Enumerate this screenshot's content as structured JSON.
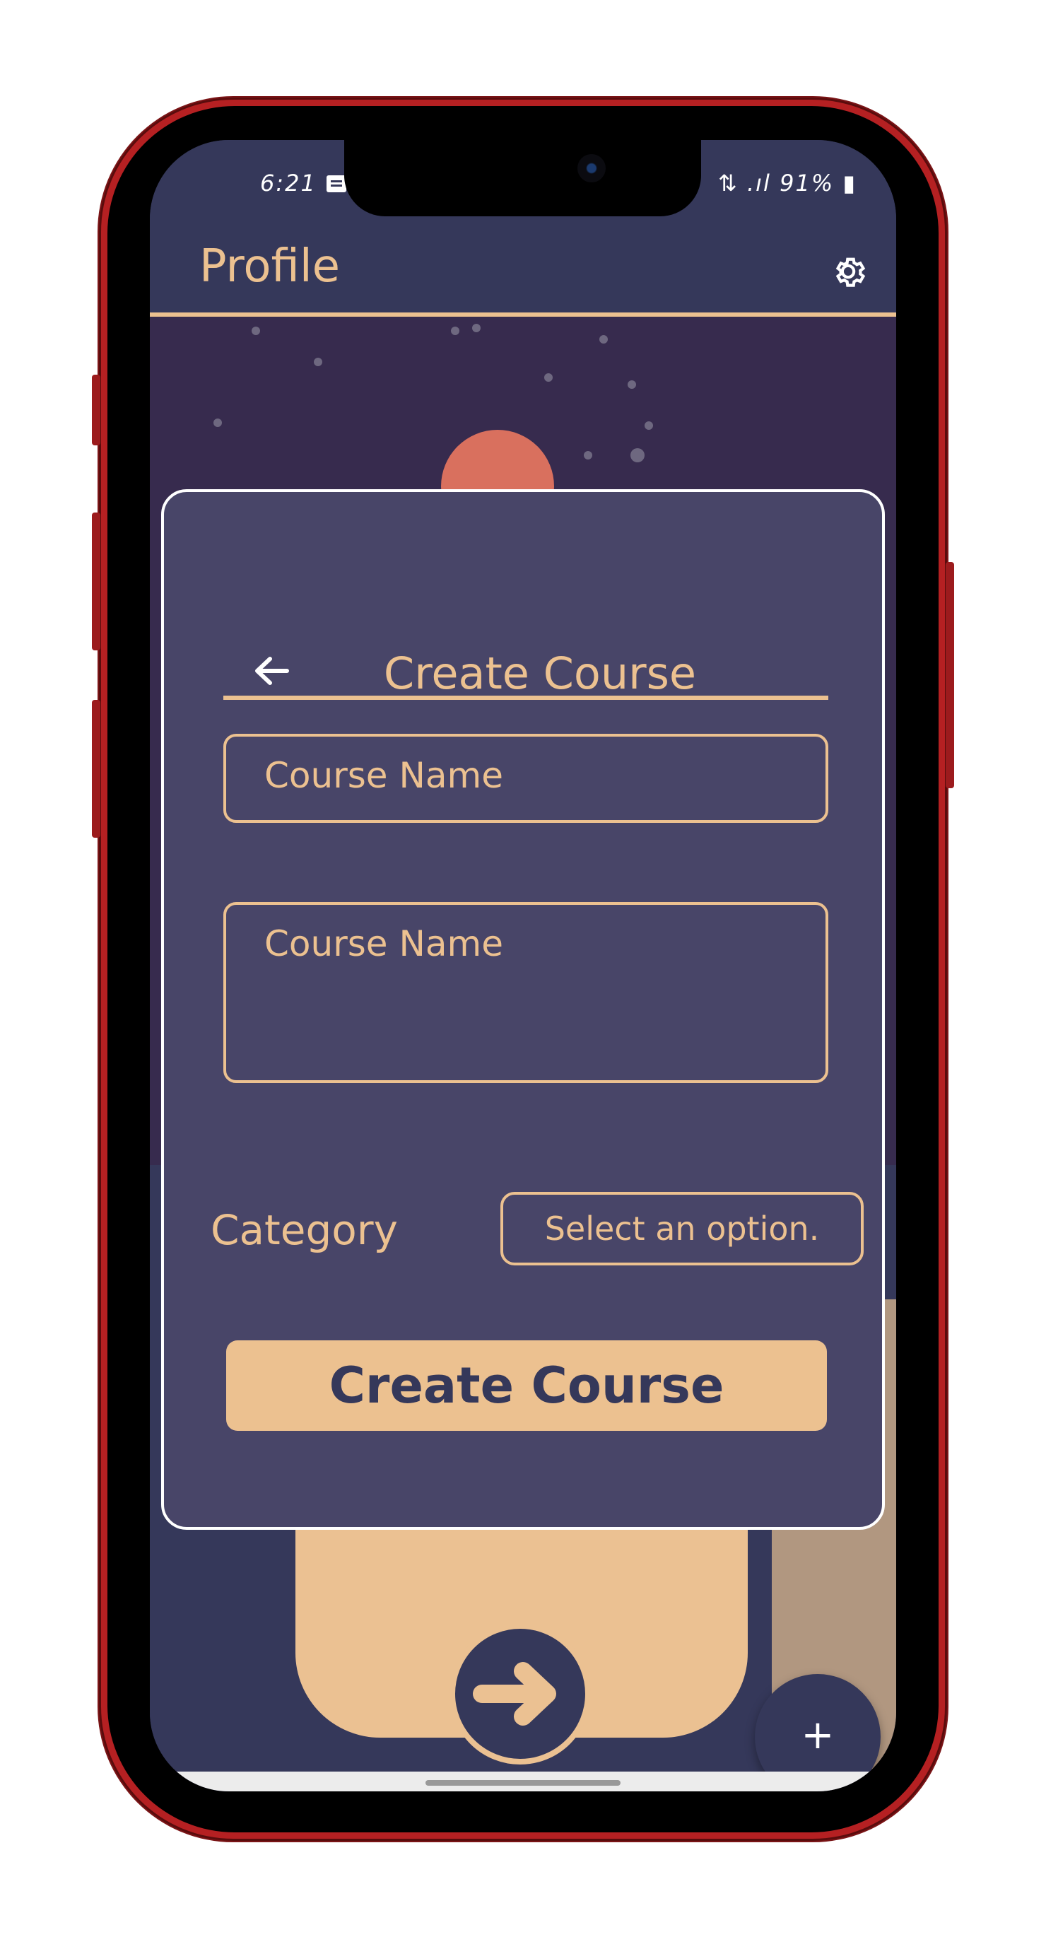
{
  "status_bar": {
    "time": "6:21",
    "battery": "91%"
  },
  "app_bar": {
    "title": "Profile",
    "settings_icon": "gear-icon"
  },
  "modal": {
    "title": "Create Course",
    "back_icon": "arrow-left-icon",
    "name_field": {
      "placeholder": "Course Name"
    },
    "description_field": {
      "placeholder": "Course Name"
    },
    "category": {
      "label": "Category",
      "selected": "Select an option."
    },
    "submit_label": "Create Course"
  },
  "fab": {
    "label": "+"
  },
  "colors": {
    "background": "#35385a",
    "modal": "#484568",
    "accent": "#ecc190",
    "sky": "#372b4e"
  }
}
